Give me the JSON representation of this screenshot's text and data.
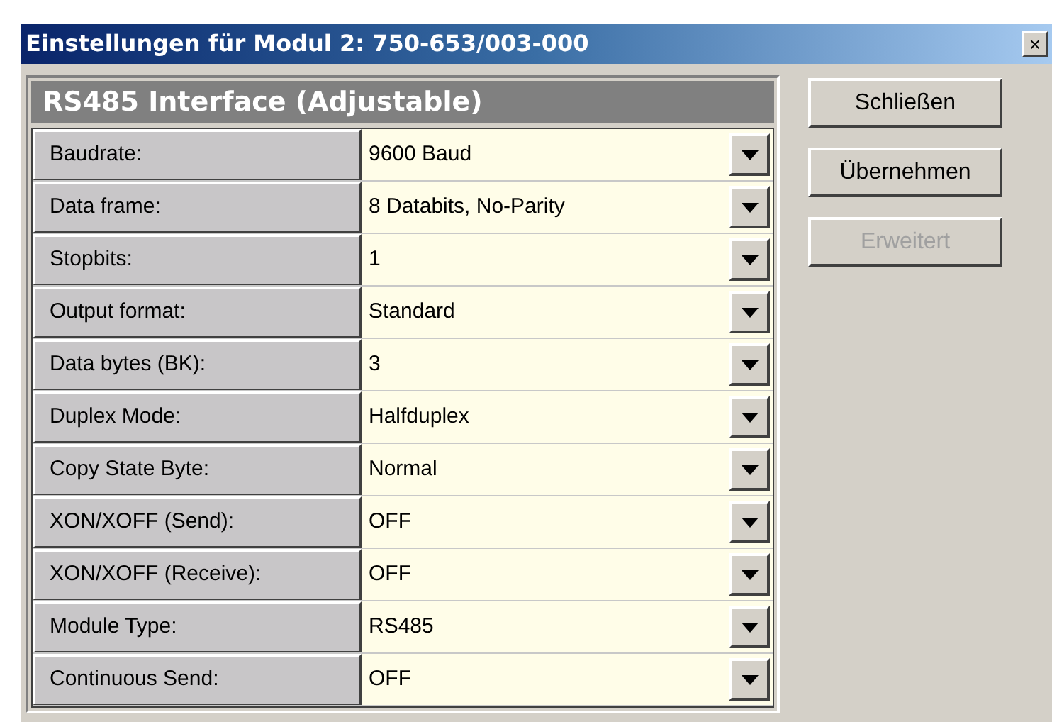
{
  "window": {
    "title": "Einstellungen für Modul 2: 750-653/003-000",
    "close": "×"
  },
  "panel": {
    "title": "RS485 Interface (Adjustable)"
  },
  "settings": [
    {
      "label": "Baudrate:",
      "value": "9600 Baud"
    },
    {
      "label": "Data frame:",
      "value": "8 Databits, No-Parity"
    },
    {
      "label": "Stopbits:",
      "value": "1"
    },
    {
      "label": "Output format:",
      "value": "Standard"
    },
    {
      "label": "Data bytes (BK):",
      "value": "3"
    },
    {
      "label": "Duplex Mode:",
      "value": "Halfduplex"
    },
    {
      "label": "Copy State Byte:",
      "value": "Normal"
    },
    {
      "label": "XON/XOFF (Send):",
      "value": "OFF"
    },
    {
      "label": "XON/XOFF (Receive):",
      "value": "OFF"
    },
    {
      "label": "Module Type:",
      "value": "RS485"
    },
    {
      "label": "Continuous Send:",
      "value": "OFF"
    }
  ],
  "buttons": [
    {
      "label": "Schließen",
      "disabled": false
    },
    {
      "label": "Übernehmen",
      "disabled": false
    },
    {
      "label": "Erweitert",
      "disabled": true
    }
  ]
}
